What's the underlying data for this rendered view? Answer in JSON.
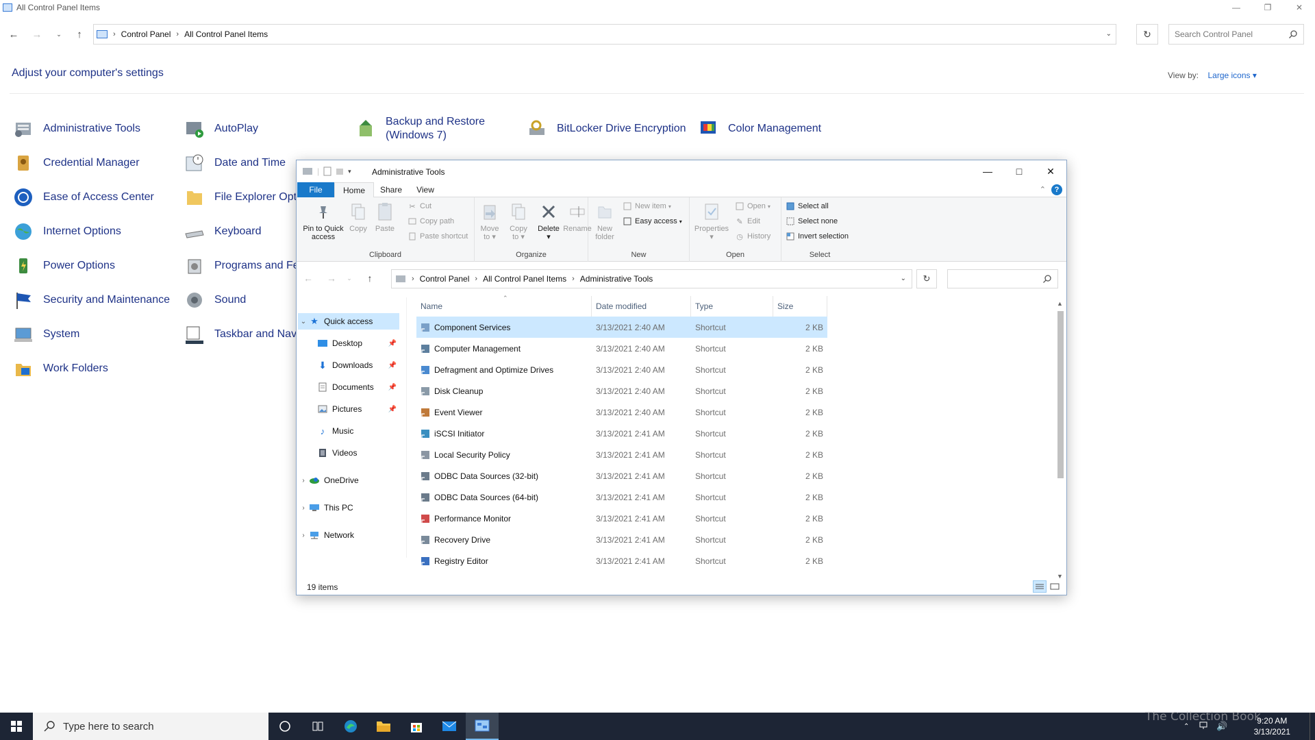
{
  "control_panel": {
    "title": "All Control Panel Items",
    "breadcrumb": [
      "Control Panel",
      "All Control Panel Items"
    ],
    "search_placeholder": "Search Control Panel",
    "heading": "Adjust your computer's settings",
    "view_by_label": "View by:",
    "view_by_value": "Large icons",
    "items": [
      {
        "label": "Administrative Tools",
        "icon": "admin-tools-icon"
      },
      {
        "label": "AutoPlay",
        "icon": "autoplay-icon"
      },
      {
        "label": "Backup and Restore",
        "label2": "(Windows 7)",
        "icon": "backup-icon"
      },
      {
        "label": "BitLocker Drive Encryption",
        "icon": "bitlocker-icon"
      },
      {
        "label": "Color Management",
        "icon": "color-management-icon"
      },
      {
        "label": "Credential Manager",
        "icon": "credential-icon"
      },
      {
        "label": "Date and Time",
        "icon": "clock-icon"
      },
      {
        "label": "Ease of Access Center",
        "icon": "ease-of-access-icon"
      },
      {
        "label": "File Explorer Opti",
        "icon": "folder-options-icon"
      },
      {
        "label": "Internet Options",
        "icon": "globe-icon"
      },
      {
        "label": "Keyboard",
        "icon": "keyboard-icon"
      },
      {
        "label": "Power Options",
        "icon": "power-icon"
      },
      {
        "label": "Programs and Fe",
        "icon": "programs-icon"
      },
      {
        "label": "Security and Maintenance",
        "icon": "flag-icon"
      },
      {
        "label": "Sound",
        "icon": "speaker-icon"
      },
      {
        "label": "System",
        "icon": "system-icon"
      },
      {
        "label": "Taskbar and Navig",
        "icon": "taskbar-icon"
      },
      {
        "label": "Work Folders",
        "icon": "work-folders-icon"
      }
    ]
  },
  "explorer": {
    "title": "Administrative Tools",
    "tabs": [
      "File",
      "Home",
      "Share",
      "View"
    ],
    "ribbon": {
      "clipboard": {
        "group": "Clipboard",
        "pin": "Pin to Quick",
        "pin2": "access",
        "copy": "Copy",
        "paste": "Paste",
        "cut": "Cut",
        "copy_path": "Copy path",
        "paste_shortcut": "Paste shortcut"
      },
      "organize": {
        "group": "Organize",
        "move": "Move",
        "move2": "to",
        "copy": "Copy",
        "copy2": "to",
        "delete": "Delete",
        "rename": "Rename"
      },
      "new": {
        "group": "New",
        "new_folder": "New",
        "new_folder2": "folder",
        "new_item": "New item",
        "easy_access": "Easy access"
      },
      "open": {
        "group": "Open",
        "properties": "Properties",
        "open": "Open",
        "edit": "Edit",
        "history": "History"
      },
      "select": {
        "group": "Select",
        "select_all": "Select all",
        "select_none": "Select none",
        "invert": "Invert selection"
      }
    },
    "breadcrumb": [
      "Control Panel",
      "All Control Panel Items",
      "Administrative Tools"
    ],
    "nav": {
      "quick_access": "Quick access",
      "pinned": [
        "Desktop",
        "Downloads",
        "Documents",
        "Pictures"
      ],
      "unpinned": [
        "Music",
        "Videos"
      ],
      "onedrive": "OneDrive",
      "this_pc": "This PC",
      "network": "Network"
    },
    "columns": [
      "Name",
      "Date modified",
      "Type",
      "Size"
    ],
    "files": [
      {
        "name": "Component Services",
        "date": "3/13/2021 2:40 AM",
        "type": "Shortcut",
        "size": "2 KB"
      },
      {
        "name": "Computer Management",
        "date": "3/13/2021 2:40 AM",
        "type": "Shortcut",
        "size": "2 KB"
      },
      {
        "name": "Defragment and Optimize Drives",
        "date": "3/13/2021 2:40 AM",
        "type": "Shortcut",
        "size": "2 KB"
      },
      {
        "name": "Disk Cleanup",
        "date": "3/13/2021 2:40 AM",
        "type": "Shortcut",
        "size": "2 KB"
      },
      {
        "name": "Event Viewer",
        "date": "3/13/2021 2:40 AM",
        "type": "Shortcut",
        "size": "2 KB"
      },
      {
        "name": "iSCSI Initiator",
        "date": "3/13/2021 2:41 AM",
        "type": "Shortcut",
        "size": "2 KB"
      },
      {
        "name": "Local Security Policy",
        "date": "3/13/2021 2:41 AM",
        "type": "Shortcut",
        "size": "2 KB"
      },
      {
        "name": "ODBC Data Sources (32-bit)",
        "date": "3/13/2021 2:41 AM",
        "type": "Shortcut",
        "size": "2 KB"
      },
      {
        "name": "ODBC Data Sources (64-bit)",
        "date": "3/13/2021 2:41 AM",
        "type": "Shortcut",
        "size": "2 KB"
      },
      {
        "name": "Performance Monitor",
        "date": "3/13/2021 2:41 AM",
        "type": "Shortcut",
        "size": "2 KB"
      },
      {
        "name": "Recovery Drive",
        "date": "3/13/2021 2:41 AM",
        "type": "Shortcut",
        "size": "2 KB"
      },
      {
        "name": "Registry Editor",
        "date": "3/13/2021 2:41 AM",
        "type": "Shortcut",
        "size": "2 KB"
      }
    ],
    "status": "19 items"
  },
  "taskbar": {
    "search_placeholder": "Type here to search",
    "time": "9:20 AM",
    "date": "3/13/2021",
    "watermark": "The Collection Book"
  },
  "colors": {
    "link_blue": "#1e3287",
    "accent": "#1979ca",
    "selection": "#cce8ff",
    "taskbar": "#1d2535"
  }
}
